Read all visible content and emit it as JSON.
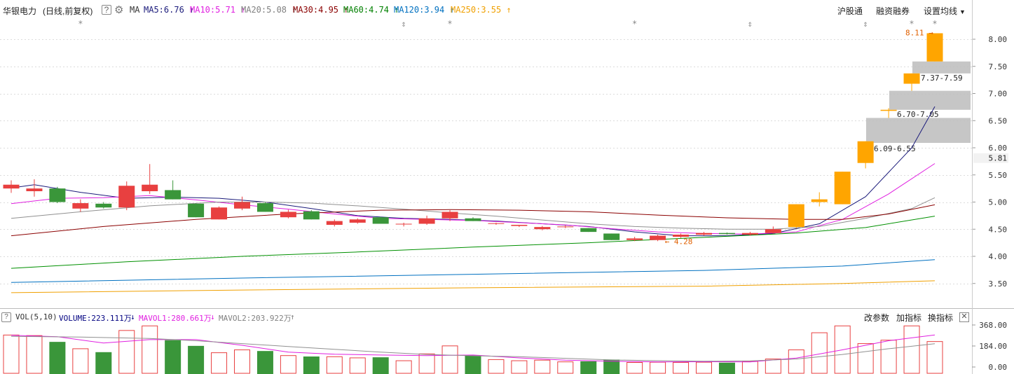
{
  "header": {
    "stock_name": "华银电力",
    "mode": "(日线,前复权)",
    "help_icon": "question-icon",
    "settings_icon": "gear-icon",
    "ma_label": "MA",
    "ma_items": [
      {
        "text": "MA5:6.76",
        "color": "#1a1a7a"
      },
      {
        "text": "MA10:5.71",
        "color": "#e020e0"
      },
      {
        "text": "MA20:5.08",
        "color": "#808080"
      },
      {
        "text": "MA30:4.95",
        "color": "#8b0000"
      },
      {
        "text": "MA60:4.74",
        "color": "#008000"
      },
      {
        "text": "MA120:3.94",
        "color": "#0070c0"
      },
      {
        "text": "MA250:3.55",
        "color": "#f0a000"
      }
    ],
    "links": [
      "沪股通",
      "融资融券",
      "设置均线"
    ]
  },
  "volume_header": {
    "title": "VOL(5,10)",
    "volume": {
      "text": "VOLUME:223.111万",
      "color": "#000080"
    },
    "mavol1": {
      "text": "MAVOL1:280.661万",
      "color": "#e020e0"
    },
    "mavol2": {
      "text": "MAVOL2:203.922万",
      "color": "#808080"
    },
    "buttons": [
      "改参数",
      "加指标",
      "换指标"
    ],
    "close_icon": "close-icon"
  },
  "chart_data": {
    "type": "candlestick",
    "price_axis": {
      "ticks": [
        "8.00",
        "7.50",
        "7.00",
        "6.50",
        "6.00",
        "5.50",
        "5.00",
        "4.50",
        "4.00",
        "3.50"
      ],
      "current_price": "5.81"
    },
    "volume_axis": {
      "ticks": [
        "368.00",
        "184.00",
        "0.00"
      ],
      "unit": "万"
    },
    "candles": [
      {
        "o": 5.25,
        "h": 5.4,
        "l": 5.17,
        "c": 5.32,
        "v": 280
      },
      {
        "o": 5.2,
        "h": 5.42,
        "l": 5.1,
        "c": 5.25,
        "v": 275
      },
      {
        "o": 5.25,
        "h": 5.28,
        "l": 4.98,
        "c": 5.0,
        "v": 220
      },
      {
        "o": 4.88,
        "h": 5.05,
        "l": 4.82,
        "c": 4.98,
        "v": 160
      },
      {
        "o": 4.97,
        "h": 5.0,
        "l": 4.88,
        "c": 4.9,
        "v": 130
      },
      {
        "o": 4.9,
        "h": 5.38,
        "l": 4.85,
        "c": 5.3,
        "v": 320
      },
      {
        "o": 5.2,
        "h": 5.7,
        "l": 5.15,
        "c": 5.32,
        "v": 360
      },
      {
        "o": 5.22,
        "h": 5.4,
        "l": 5.05,
        "c": 5.05,
        "v": 235
      },
      {
        "o": 4.97,
        "h": 4.98,
        "l": 4.72,
        "c": 4.72,
        "v": 185
      },
      {
        "o": 4.68,
        "h": 4.92,
        "l": 4.68,
        "c": 4.9,
        "v": 125
      },
      {
        "o": 4.88,
        "h": 5.1,
        "l": 4.85,
        "c": 5.0,
        "v": 150
      },
      {
        "o": 4.98,
        "h": 5.0,
        "l": 4.82,
        "c": 4.82,
        "v": 140
      },
      {
        "o": 4.72,
        "h": 4.86,
        "l": 4.7,
        "c": 4.82,
        "v": 100
      },
      {
        "o": 4.83,
        "h": 4.85,
        "l": 4.68,
        "c": 4.68,
        "v": 92
      },
      {
        "o": 4.58,
        "h": 4.68,
        "l": 4.55,
        "c": 4.65,
        "v": 90
      },
      {
        "o": 4.62,
        "h": 4.7,
        "l": 4.6,
        "c": 4.68,
        "v": 80
      },
      {
        "o": 4.72,
        "h": 4.73,
        "l": 4.6,
        "c": 4.6,
        "v": 85
      },
      {
        "o": 4.6,
        "h": 4.62,
        "l": 4.55,
        "c": 4.6,
        "v": 55
      },
      {
        "o": 4.6,
        "h": 4.75,
        "l": 4.58,
        "c": 4.7,
        "v": 115
      },
      {
        "o": 4.7,
        "h": 4.85,
        "l": 4.65,
        "c": 4.82,
        "v": 185
      },
      {
        "o": 4.7,
        "h": 4.72,
        "l": 4.65,
        "c": 4.65,
        "v": 100
      },
      {
        "o": 4.6,
        "h": 4.62,
        "l": 4.58,
        "c": 4.61,
        "v": 65
      },
      {
        "o": 4.56,
        "h": 4.58,
        "l": 4.54,
        "c": 4.58,
        "v": 55
      },
      {
        "o": 4.5,
        "h": 4.56,
        "l": 4.48,
        "c": 4.54,
        "v": 60
      },
      {
        "o": 4.55,
        "h": 4.57,
        "l": 4.52,
        "c": 4.55,
        "v": 45
      },
      {
        "o": 4.52,
        "h": 4.52,
        "l": 4.45,
        "c": 4.45,
        "v": 50
      },
      {
        "o": 4.42,
        "h": 4.42,
        "l": 4.3,
        "c": 4.3,
        "v": 65
      },
      {
        "o": 4.3,
        "h": 4.36,
        "l": 4.28,
        "c": 4.33,
        "v": 40
      },
      {
        "o": 4.3,
        "h": 4.4,
        "l": 4.28,
        "c": 4.38,
        "v": 42
      },
      {
        "o": 4.36,
        "h": 4.42,
        "l": 4.34,
        "c": 4.4,
        "v": 40
      },
      {
        "o": 4.4,
        "h": 4.45,
        "l": 4.38,
        "c": 4.43,
        "v": 42
      },
      {
        "o": 4.43,
        "h": 4.44,
        "l": 4.4,
        "c": 4.41,
        "v": 38
      },
      {
        "o": 4.4,
        "h": 4.45,
        "l": 4.38,
        "c": 4.43,
        "v": 48
      },
      {
        "o": 4.43,
        "h": 4.55,
        "l": 4.42,
        "c": 4.5,
        "v": 70
      },
      {
        "o": 4.54,
        "h": 4.96,
        "l": 4.52,
        "c": 4.96,
        "v": 150
      },
      {
        "o": 5.0,
        "h": 5.18,
        "l": 4.92,
        "c": 5.05,
        "v": 300
      },
      {
        "o": 4.96,
        "h": 5.56,
        "l": 4.96,
        "c": 5.56,
        "v": 360
      },
      {
        "o": 5.72,
        "h": 6.12,
        "l": 5.62,
        "c": 6.12,
        "v": 205
      },
      {
        "o": 6.68,
        "h": 6.73,
        "l": 6.55,
        "c": 6.7,
        "v": 235
      },
      {
        "o": 7.18,
        "h": 7.37,
        "l": 7.05,
        "c": 7.37,
        "v": 360
      },
      {
        "o": 7.59,
        "h": 8.11,
        "l": 7.59,
        "c": 8.11,
        "v": 223
      }
    ],
    "ma_lines": {
      "MA5": [
        [
          0,
          5.26
        ],
        [
          1,
          5.32
        ],
        [
          3,
          5.18
        ],
        [
          5,
          5.07
        ],
        [
          7,
          5.09
        ],
        [
          9,
          5.07
        ],
        [
          11,
          5.0
        ],
        [
          13,
          4.88
        ],
        [
          15,
          4.75
        ],
        [
          17,
          4.7
        ],
        [
          19,
          4.68
        ],
        [
          21,
          4.65
        ],
        [
          23,
          4.6
        ],
        [
          25,
          4.55
        ],
        [
          27,
          4.45
        ],
        [
          29,
          4.38
        ],
        [
          31,
          4.38
        ],
        [
          33,
          4.42
        ],
        [
          35,
          4.6
        ],
        [
          37,
          5.1
        ],
        [
          39,
          6.0
        ],
        [
          40,
          6.76
        ]
      ],
      "MA10": [
        [
          0,
          4.97
        ],
        [
          2,
          5.07
        ],
        [
          4,
          5.08
        ],
        [
          6,
          5.12
        ],
        [
          8,
          5.04
        ],
        [
          10,
          4.95
        ],
        [
          12,
          4.87
        ],
        [
          14,
          4.78
        ],
        [
          16,
          4.7
        ],
        [
          18,
          4.68
        ],
        [
          20,
          4.66
        ],
        [
          22,
          4.62
        ],
        [
          24,
          4.58
        ],
        [
          26,
          4.51
        ],
        [
          28,
          4.45
        ],
        [
          30,
          4.42
        ],
        [
          32,
          4.41
        ],
        [
          34,
          4.45
        ],
        [
          36,
          4.68
        ],
        [
          38,
          5.15
        ],
        [
          40,
          5.71
        ]
      ],
      "MA20": [
        [
          0,
          4.7
        ],
        [
          3,
          4.82
        ],
        [
          6,
          4.93
        ],
        [
          9,
          5.0
        ],
        [
          11,
          5.0
        ],
        [
          13,
          4.98
        ],
        [
          15,
          4.93
        ],
        [
          17,
          4.87
        ],
        [
          19,
          4.8
        ],
        [
          21,
          4.74
        ],
        [
          23,
          4.67
        ],
        [
          25,
          4.6
        ],
        [
          27,
          4.55
        ],
        [
          29,
          4.52
        ],
        [
          31,
          4.5
        ],
        [
          33,
          4.5
        ],
        [
          35,
          4.55
        ],
        [
          37,
          4.7
        ],
        [
          39,
          4.88
        ],
        [
          40,
          5.08
        ]
      ],
      "MA30": [
        [
          0,
          4.38
        ],
        [
          4,
          4.55
        ],
        [
          8,
          4.68
        ],
        [
          12,
          4.78
        ],
        [
          16,
          4.85
        ],
        [
          19,
          4.86
        ],
        [
          22,
          4.85
        ],
        [
          25,
          4.82
        ],
        [
          28,
          4.76
        ],
        [
          31,
          4.71
        ],
        [
          34,
          4.68
        ],
        [
          36,
          4.68
        ],
        [
          38,
          4.78
        ],
        [
          40,
          4.95
        ]
      ],
      "MA60": [
        [
          0,
          3.78
        ],
        [
          5,
          3.9
        ],
        [
          10,
          4.0
        ],
        [
          15,
          4.08
        ],
        [
          20,
          4.17
        ],
        [
          25,
          4.25
        ],
        [
          30,
          4.35
        ],
        [
          34,
          4.43
        ],
        [
          37,
          4.53
        ],
        [
          40,
          4.74
        ]
      ],
      "MA120": [
        [
          0,
          3.52
        ],
        [
          10,
          3.6
        ],
        [
          20,
          3.67
        ],
        [
          30,
          3.74
        ],
        [
          36,
          3.82
        ],
        [
          40,
          3.94
        ]
      ],
      "MA250": [
        [
          0,
          3.33
        ],
        [
          10,
          3.38
        ],
        [
          20,
          3.42
        ],
        [
          30,
          3.45
        ],
        [
          36,
          3.5
        ],
        [
          40,
          3.55
        ]
      ]
    },
    "mavol1": [
      [
        0,
        278
      ],
      [
        2,
        265
      ],
      [
        4,
        210
      ],
      [
        6,
        240
      ],
      [
        8,
        240
      ],
      [
        10,
        190
      ],
      [
        12,
        130
      ],
      [
        14,
        112
      ],
      [
        16,
        105
      ],
      [
        18,
        100
      ],
      [
        20,
        105
      ],
      [
        22,
        80
      ],
      [
        24,
        60
      ],
      [
        26,
        50
      ],
      [
        28,
        45
      ],
      [
        30,
        46
      ],
      [
        32,
        44
      ],
      [
        34,
        78
      ],
      [
        36,
        150
      ],
      [
        38,
        230
      ],
      [
        40,
        281
      ]
    ],
    "mavol2": [
      [
        0,
        268
      ],
      [
        3,
        262
      ],
      [
        6,
        250
      ],
      [
        8,
        230
      ],
      [
        10,
        205
      ],
      [
        12,
        180
      ],
      [
        14,
        155
      ],
      [
        16,
        130
      ],
      [
        18,
        110
      ],
      [
        20,
        98
      ],
      [
        22,
        90
      ],
      [
        24,
        76
      ],
      [
        26,
        62
      ],
      [
        28,
        55
      ],
      [
        30,
        50
      ],
      [
        32,
        54
      ],
      [
        34,
        70
      ],
      [
        36,
        110
      ],
      [
        38,
        160
      ],
      [
        40,
        204
      ]
    ],
    "annotations": {
      "high_label": "8.11",
      "low_label": "4.28",
      "bands": [
        {
          "lo": 7.37,
          "hi": 7.59,
          "label": "7.37-7.59"
        },
        {
          "lo": 6.7,
          "hi": 7.05,
          "label": "6.70-7.05"
        },
        {
          "lo": 6.09,
          "hi": 6.55,
          "label": "6.09-6.55"
        }
      ],
      "event_markers": [
        {
          "idx": 3,
          "symbol": "*"
        },
        {
          "idx": 17,
          "symbol": "⇕"
        },
        {
          "idx": 19,
          "symbol": "*"
        },
        {
          "idx": 27,
          "symbol": "*"
        },
        {
          "idx": 32,
          "symbol": "⇕"
        },
        {
          "idx": 37,
          "symbol": "⇕"
        },
        {
          "idx": 39,
          "symbol": "*"
        },
        {
          "idx": 40,
          "symbol": "*"
        }
      ]
    },
    "colors": {
      "up": "#e84040",
      "down": "#3a963a",
      "limit_up": "#ffa500",
      "band": "#c0c0c0"
    }
  }
}
